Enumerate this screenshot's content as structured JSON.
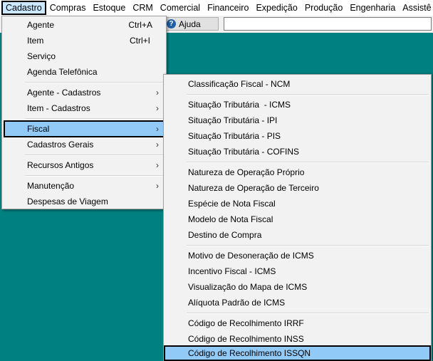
{
  "menubar": {
    "items": [
      "Cadastro",
      "Compras",
      "Estoque",
      "CRM",
      "Comercial",
      "Financeiro",
      "Expedição",
      "Produção",
      "Engenharia",
      "Assistê"
    ]
  },
  "toolbar": {
    "help_label": "Ajuda",
    "help_icon": "help-icon"
  },
  "main_menu": {
    "items": [
      {
        "label": "Agente",
        "shortcut": "Ctrl+A"
      },
      {
        "label": "Item",
        "shortcut": "Ctrl+I"
      },
      {
        "label": "Serviço"
      },
      {
        "label": "Agenda Telefônica"
      },
      {
        "label": "Agente - Cadastros",
        "arrow": "›"
      },
      {
        "label": "Item - Cadastros",
        "arrow": "›"
      },
      {
        "label": "Fiscal",
        "arrow": "›"
      },
      {
        "label": "Cadastros Gerais",
        "arrow": "›"
      },
      {
        "label": "Recursos Antigos",
        "arrow": "›"
      },
      {
        "label": "Manutenção",
        "arrow": "›"
      },
      {
        "label": "Despesas de Viagem"
      }
    ]
  },
  "sub_menu": {
    "items": [
      "Classificação Fiscal - NCM",
      "Situação Tributária  - ICMS",
      "Situação Tributária - IPI",
      "Situação Tributária - PIS",
      "Situação Tributária - COFINS",
      "Natureza de Operação Próprio",
      "Natureza de Operação de Terceiro",
      "Espécie de Nota Fiscal",
      "Modelo de Nota Fiscal",
      "Destino de Compra",
      "Motivo de Desoneração de ICMS",
      "Incentivo Fiscal - ICMS",
      "Visualização do Mapa de ICMS",
      "Alíquota Padrão de ICMS",
      "Código de Recolhimento IRRF",
      "Código de Recolhimento INSS",
      "Código de Recolhimento ISSQN"
    ]
  },
  "colors": {
    "workspace": "#008080",
    "selection": "#91c9f7",
    "menubar_active": "#cce8ff"
  }
}
